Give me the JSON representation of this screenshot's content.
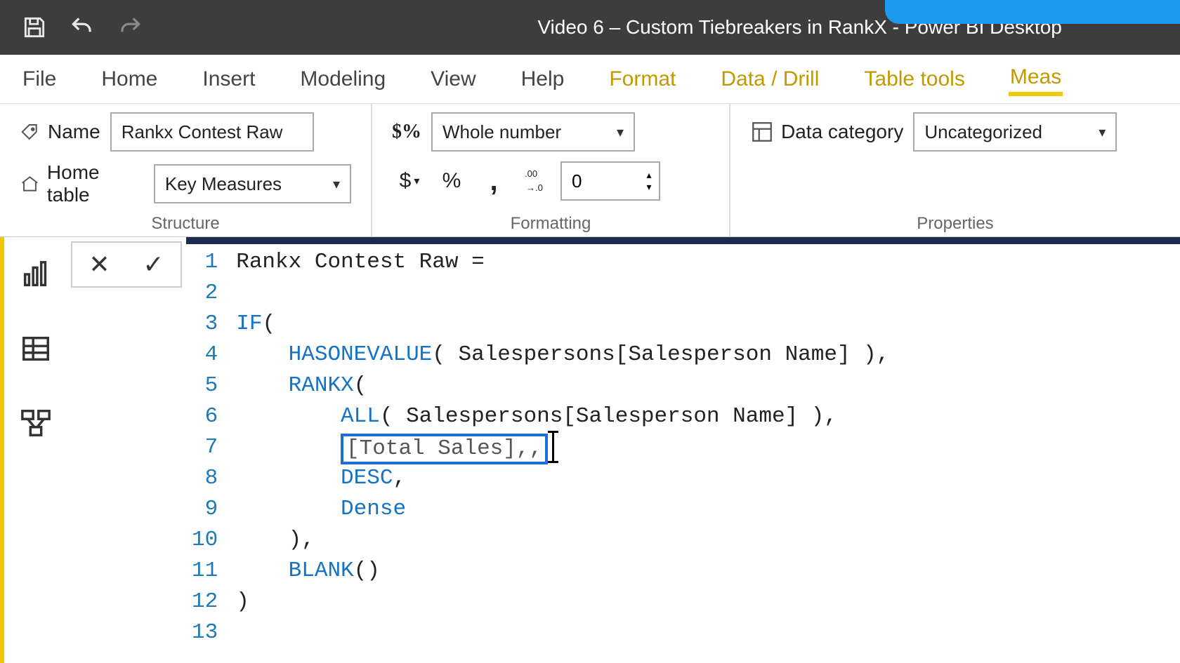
{
  "title": "Video 6 – Custom Tiebreakers in RankX - Power BI Desktop",
  "ribbon": {
    "tabs": [
      "File",
      "Home",
      "Insert",
      "Modeling",
      "View",
      "Help",
      "Format",
      "Data / Drill",
      "Table tools",
      "Meas"
    ],
    "contextual_start_index": 6,
    "active_index": 9
  },
  "structure": {
    "name_label": "Name",
    "name_value": "Rankx Contest Raw",
    "home_table_label": "Home table",
    "home_table_value": "Key Measures",
    "group_label": "Structure"
  },
  "formatting": {
    "format_value": "Whole number",
    "decimal_places": "0",
    "group_label": "Formatting",
    "currency": "$",
    "percent": "%",
    "thousands": ",",
    "decimals_icon": ".00→.0"
  },
  "properties": {
    "data_category_label": "Data category",
    "data_category_value": "Uncategorized",
    "group_label": "Properties"
  },
  "editor": {
    "lines": [
      {
        "n": "1",
        "tokens": [
          {
            "t": "Rankx Contest Raw = ",
            "c": "ident"
          }
        ]
      },
      {
        "n": "2",
        "tokens": []
      },
      {
        "n": "3",
        "tokens": [
          {
            "t": "IF",
            "c": "kw-fn"
          },
          {
            "t": "(",
            "c": "ident"
          }
        ]
      },
      {
        "n": "4",
        "tokens": [
          {
            "t": "    ",
            "c": ""
          },
          {
            "t": "HASONEVALUE",
            "c": "kw-fn"
          },
          {
            "t": "( Salespersons[Salesperson Name] ),",
            "c": "ident"
          }
        ]
      },
      {
        "n": "5",
        "tokens": [
          {
            "t": "    ",
            "c": ""
          },
          {
            "t": "RANKX",
            "c": "kw-fn"
          },
          {
            "t": "(",
            "c": "ident"
          }
        ]
      },
      {
        "n": "6",
        "tokens": [
          {
            "t": "        ",
            "c": ""
          },
          {
            "t": "ALL",
            "c": "kw-fn"
          },
          {
            "t": "( Salespersons[Salesperson Name] ),",
            "c": "ident"
          }
        ]
      },
      {
        "n": "7",
        "tokens": [
          {
            "t": "        ",
            "c": ""
          },
          {
            "t": "[Total Sales],,",
            "c": "measure",
            "box": true
          }
        ],
        "cursor": true
      },
      {
        "n": "8",
        "tokens": [
          {
            "t": "        ",
            "c": ""
          },
          {
            "t": "DESC",
            "c": "kw-lit"
          },
          {
            "t": ",",
            "c": "ident"
          }
        ]
      },
      {
        "n": "9",
        "tokens": [
          {
            "t": "        ",
            "c": ""
          },
          {
            "t": "Dense",
            "c": "kw-lit"
          }
        ]
      },
      {
        "n": "10",
        "tokens": [
          {
            "t": "    ),",
            "c": "ident"
          }
        ]
      },
      {
        "n": "11",
        "tokens": [
          {
            "t": "    ",
            "c": ""
          },
          {
            "t": "BLANK",
            "c": "kw-fn"
          },
          {
            "t": "()",
            "c": "ident"
          }
        ]
      },
      {
        "n": "12",
        "tokens": [
          {
            "t": ")",
            "c": "ident"
          }
        ]
      },
      {
        "n": "13",
        "tokens": []
      }
    ]
  }
}
